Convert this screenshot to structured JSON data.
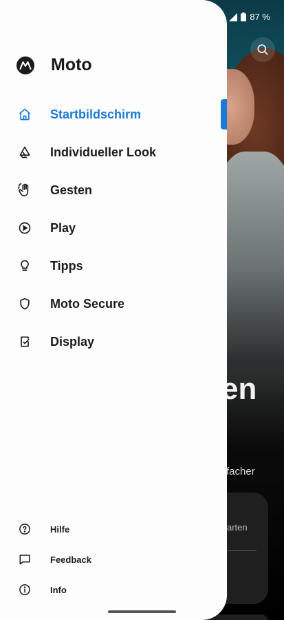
{
  "status_bar": {
    "battery": "87 %"
  },
  "drawer": {
    "title": "Moto",
    "items": [
      {
        "label": "Startbildschirm",
        "icon": "home-icon",
        "active": true
      },
      {
        "label": "Individueller Look",
        "icon": "brush-icon",
        "active": false
      },
      {
        "label": "Gesten",
        "icon": "hand-gesture-icon",
        "active": false
      },
      {
        "label": "Play",
        "icon": "play-icon",
        "active": false
      },
      {
        "label": "Tipps",
        "icon": "lightbulb-icon",
        "active": false
      },
      {
        "label": "Moto Secure",
        "icon": "shield-icon",
        "active": false
      },
      {
        "label": "Display",
        "icon": "display-icon",
        "active": false
      }
    ],
    "footer": [
      {
        "label": "Hilfe",
        "icon": "help-icon"
      },
      {
        "label": "Feedback",
        "icon": "feedback-icon"
      },
      {
        "label": "Info",
        "icon": "info-icon"
      }
    ]
  },
  "background": {
    "headline_fragment": "en",
    "subtext_fragment": "facher",
    "card_text_fragment": "arten"
  },
  "colors": {
    "accent": "#1d7ad4",
    "drawer_bg": "#fdfdfd",
    "text": "#1c1c1c"
  }
}
